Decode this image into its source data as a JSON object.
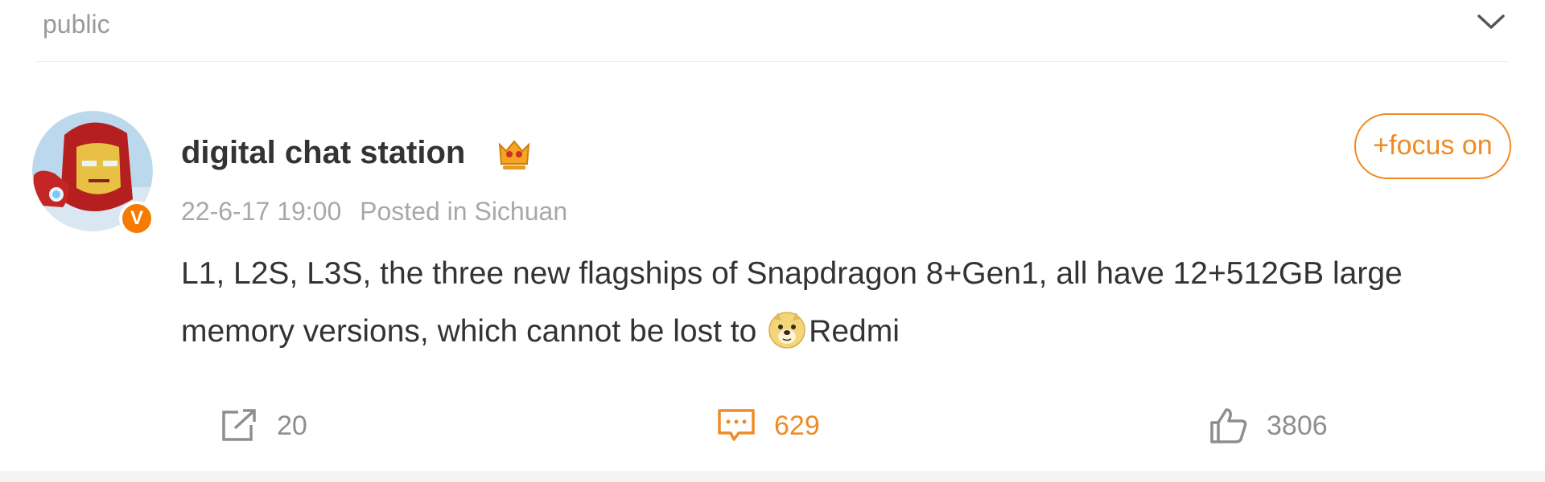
{
  "header": {
    "visibility": "public"
  },
  "post": {
    "author": {
      "name": "digital chat station",
      "verified": true,
      "verified_badge_letter": "V"
    },
    "follow_label": "+focus on",
    "timestamp": "22-6-17 19:00",
    "location": "Posted in Sichuan",
    "text_before_emoji": "L1, L2S, L3S, the three new flagships of Snapdragon 8+Gen1, all have 12+512GB large memory versions, which cannot be lost to ",
    "emoji": "doge-icon",
    "text_after_emoji": "Redmi",
    "actions": {
      "repost_count": "20",
      "comment_count": "629",
      "like_count": "3806"
    }
  },
  "colors": {
    "accent": "#f08a24",
    "verified": "#f57c00",
    "text": "#333333",
    "muted": "#a8a8a8"
  }
}
